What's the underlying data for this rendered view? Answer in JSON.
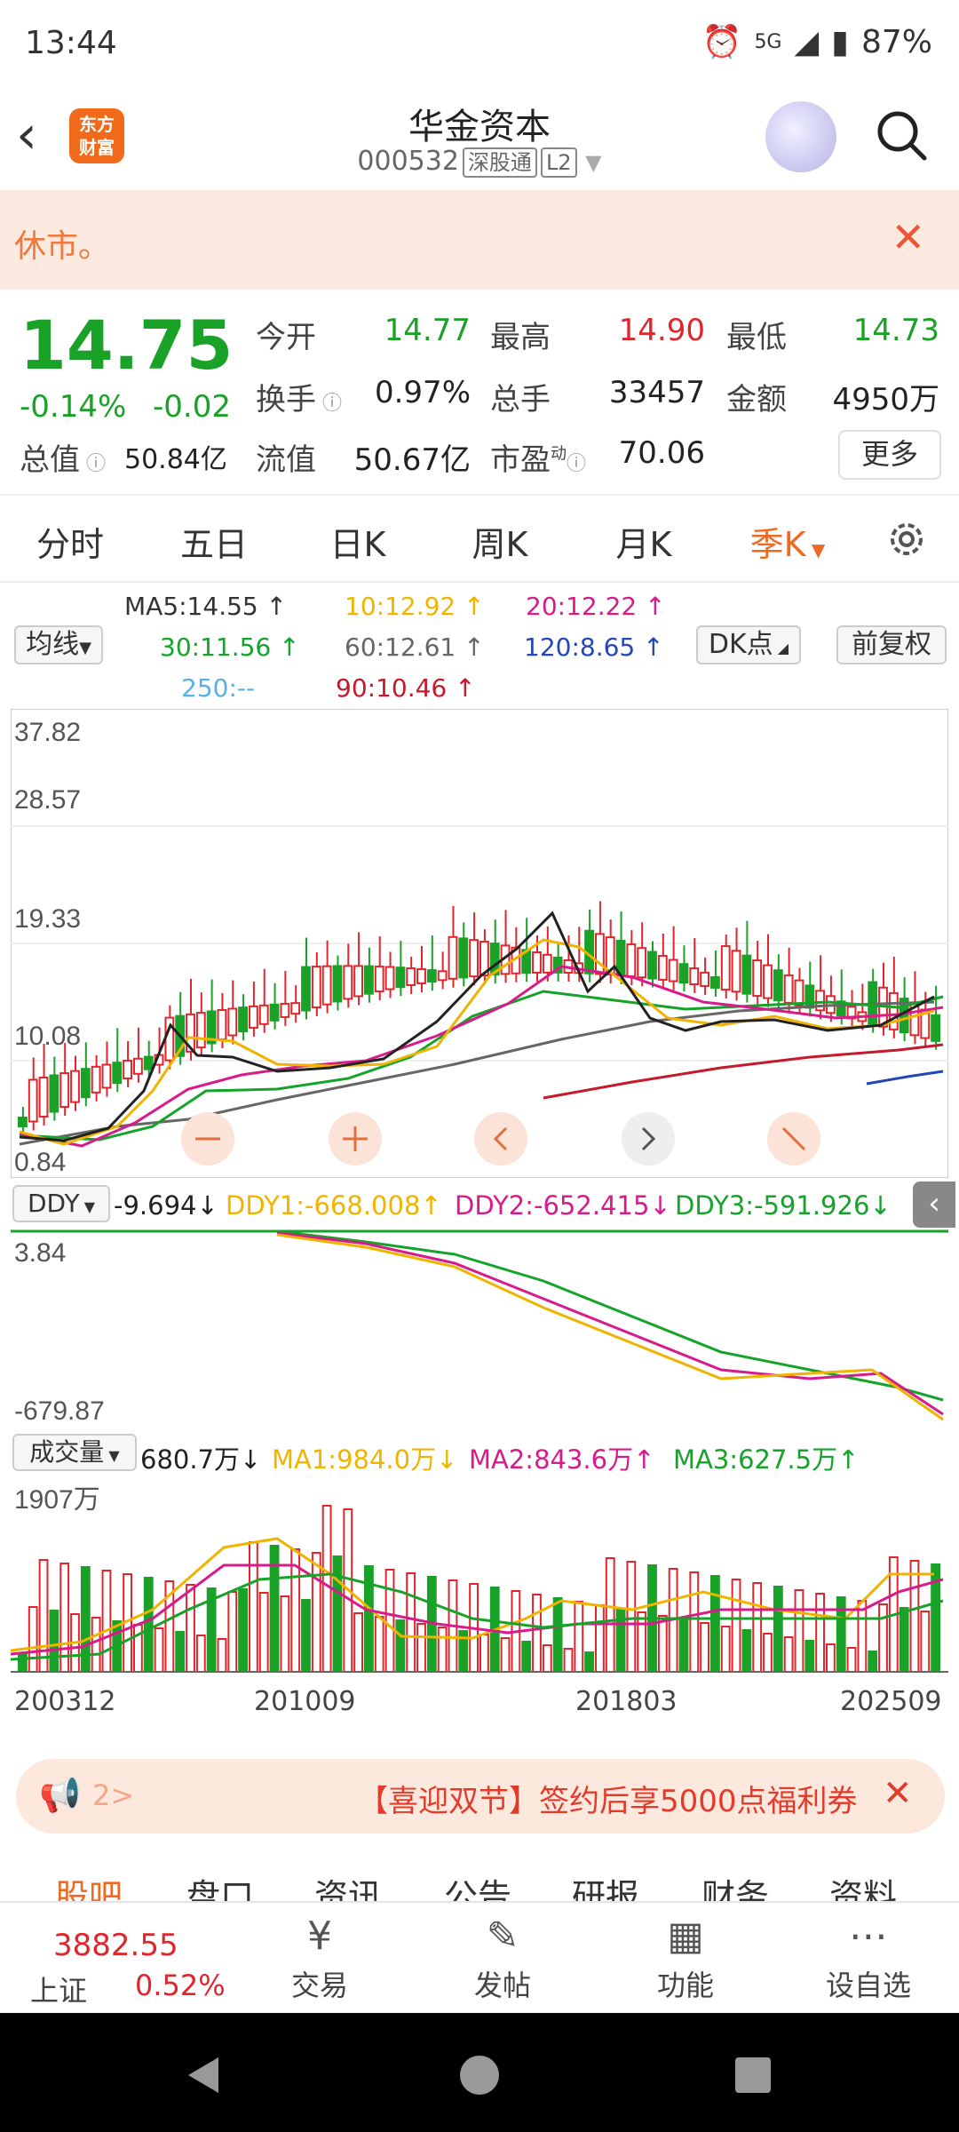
{
  "status": {
    "time": "13:44",
    "network": "5G",
    "battery": "87%"
  },
  "header": {
    "back_icon": "chevron-left-icon",
    "logo_line1": "东方",
    "logo_line2": "财富",
    "title": "华金资本",
    "code": "000532",
    "tag1": "深股通",
    "tag2": "L2"
  },
  "notice": {
    "text": "休市。"
  },
  "quote": {
    "price": "14.75",
    "change_pct": "-0.14%",
    "change": "-0.02",
    "open_label": "今开",
    "open": "14.77",
    "high_label": "最高",
    "high": "14.90",
    "low_label": "最低",
    "low": "14.73",
    "turnover_label": "换手",
    "turnover": "0.97%",
    "volume_label": "总手",
    "volume": "33457",
    "amount_label": "金额",
    "amount": "4950万",
    "mktcap_label": "总值",
    "mktcap": "50.84亿",
    "float_label": "流值",
    "float": "50.67亿",
    "pe_label": "市盈",
    "pe_sup": "动",
    "pe": "70.06",
    "more": "更多"
  },
  "tabs": [
    "分时",
    "五日",
    "日K",
    "周K",
    "月K",
    "季K"
  ],
  "ma": {
    "selector": "均线",
    "ma5": "MA5:14.55",
    "ma10": "10:12.92",
    "ma20": "20:12.22",
    "ma30": "30:11.56",
    "ma60": "60:12.61",
    "ma120": "120:8.65",
    "ma250": "250:--",
    "ma90": "90:10.46",
    "dk": "DK点",
    "fq": "前复权"
  },
  "chart_axis": {
    "y1": "37.82",
    "y2": "28.57",
    "y3": "19.33",
    "y4": "10.08",
    "y5": "0.84"
  },
  "ddy": {
    "selector": "DDY",
    "value": "-9.694",
    "ddy1": "DDY1:-668.008",
    "ddy2": "DDY2:-652.415",
    "ddy3": "DDY3:-591.926",
    "top": "3.84",
    "bottom": "-679.87"
  },
  "vol": {
    "selector": "成交量",
    "value": "680.7万",
    "ma1": "MA1:984.0万",
    "ma2": "MA2:843.6万",
    "ma3": "MA3:627.5万",
    "top": "1907万"
  },
  "x_axis": [
    "200312",
    "201009",
    "201803",
    "202509"
  ],
  "banner": {
    "text": "【喜迎双节】签约后享5000点福利券",
    "arrow": "2>"
  },
  "subtabs": [
    "股吧",
    "盘口",
    "资讯",
    "公告",
    "研报",
    "财务",
    "资料"
  ],
  "bottom_nav": {
    "index_value": "3882.55",
    "index_name": "上证",
    "index_pct": "0.52%",
    "items": [
      {
        "label": "交易",
        "icon": "yen-icon"
      },
      {
        "label": "发帖",
        "icon": "edit-icon"
      },
      {
        "label": "功能",
        "icon": "grid-icon"
      },
      {
        "label": "设自选",
        "icon": "more-icon"
      }
    ]
  },
  "colors": {
    "up": "#e0262c",
    "down": "#1aa128",
    "accent": "#ee6a22",
    "ma10": "#f0b400",
    "ma20": "#d81b8a",
    "ma30": "#15a32a",
    "ma60": "#666666",
    "ma120": "#2446b8",
    "ma250": "#5ab0e8",
    "ma90": "#c41a2c"
  }
}
